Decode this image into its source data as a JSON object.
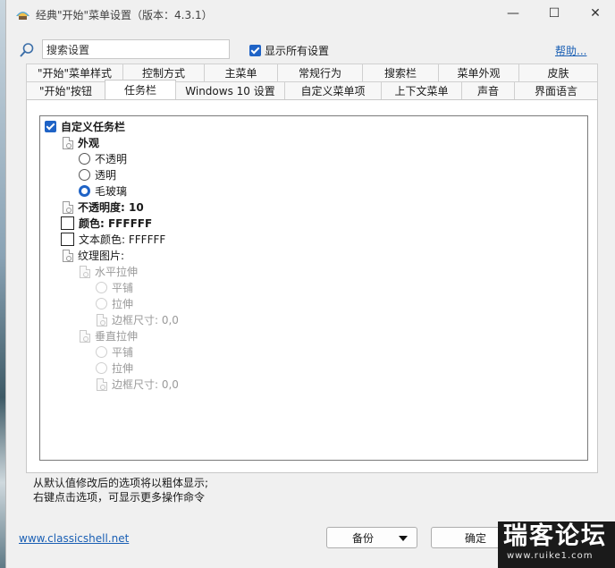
{
  "window": {
    "title": "经典\"开始\"菜单设置（版本：4.3.1）",
    "minimize_glyph": "—",
    "maximize_glyph": "☐",
    "close_glyph": "✕"
  },
  "search": {
    "value": "搜索设置",
    "icon": "search-icon"
  },
  "show_all": {
    "label": "显示所有设置",
    "checked": true
  },
  "help": {
    "label": "帮助..."
  },
  "tabs": {
    "row1": [
      {
        "label": "\"开始\"菜单样式"
      },
      {
        "label": "控制方式"
      },
      {
        "label": "主菜单"
      },
      {
        "label": "常规行为"
      },
      {
        "label": "搜索栏"
      },
      {
        "label": "菜单外观"
      },
      {
        "label": "皮肤"
      }
    ],
    "row2": [
      {
        "label": "\"开始\"按钮"
      },
      {
        "label": "任务栏",
        "active": true
      },
      {
        "label": "Windows 10 设置"
      },
      {
        "label": "自定义菜单项"
      },
      {
        "label": "上下文菜单"
      },
      {
        "label": "声音"
      },
      {
        "label": "界面语言"
      }
    ]
  },
  "tree": {
    "root": "自定义任务栏",
    "appearance": "外观",
    "opt_opaque": "不透明",
    "opt_transparent": "透明",
    "opt_glass": "毛玻璃",
    "opacity": "不透明度: 10",
    "color": "颜色: FFFFFF",
    "text_color": "文本颜色: FFFFFF",
    "texture": "纹理图片:",
    "h_stretch": "水平拉伸",
    "h_tile": "平铺",
    "h_stretch_opt": "拉伸",
    "h_border": "边框尺寸: 0,0",
    "v_stretch": "垂直拉伸",
    "v_tile": "平铺",
    "v_stretch_opt": "拉伸",
    "v_border": "边框尺寸: 0,0"
  },
  "hints": {
    "line1": "从默认值修改后的选项将以粗体显示;",
    "line2": "右键点击选项，可显示更多操作命令"
  },
  "footer": {
    "site": "www.classicshell.net",
    "backup": "备份",
    "ok": "确定"
  },
  "watermark": {
    "main": "瑞客论坛",
    "sub": "www.ruike1.com"
  },
  "colors": {
    "accent": "#1f63c6",
    "link": "#1a5fb4"
  }
}
